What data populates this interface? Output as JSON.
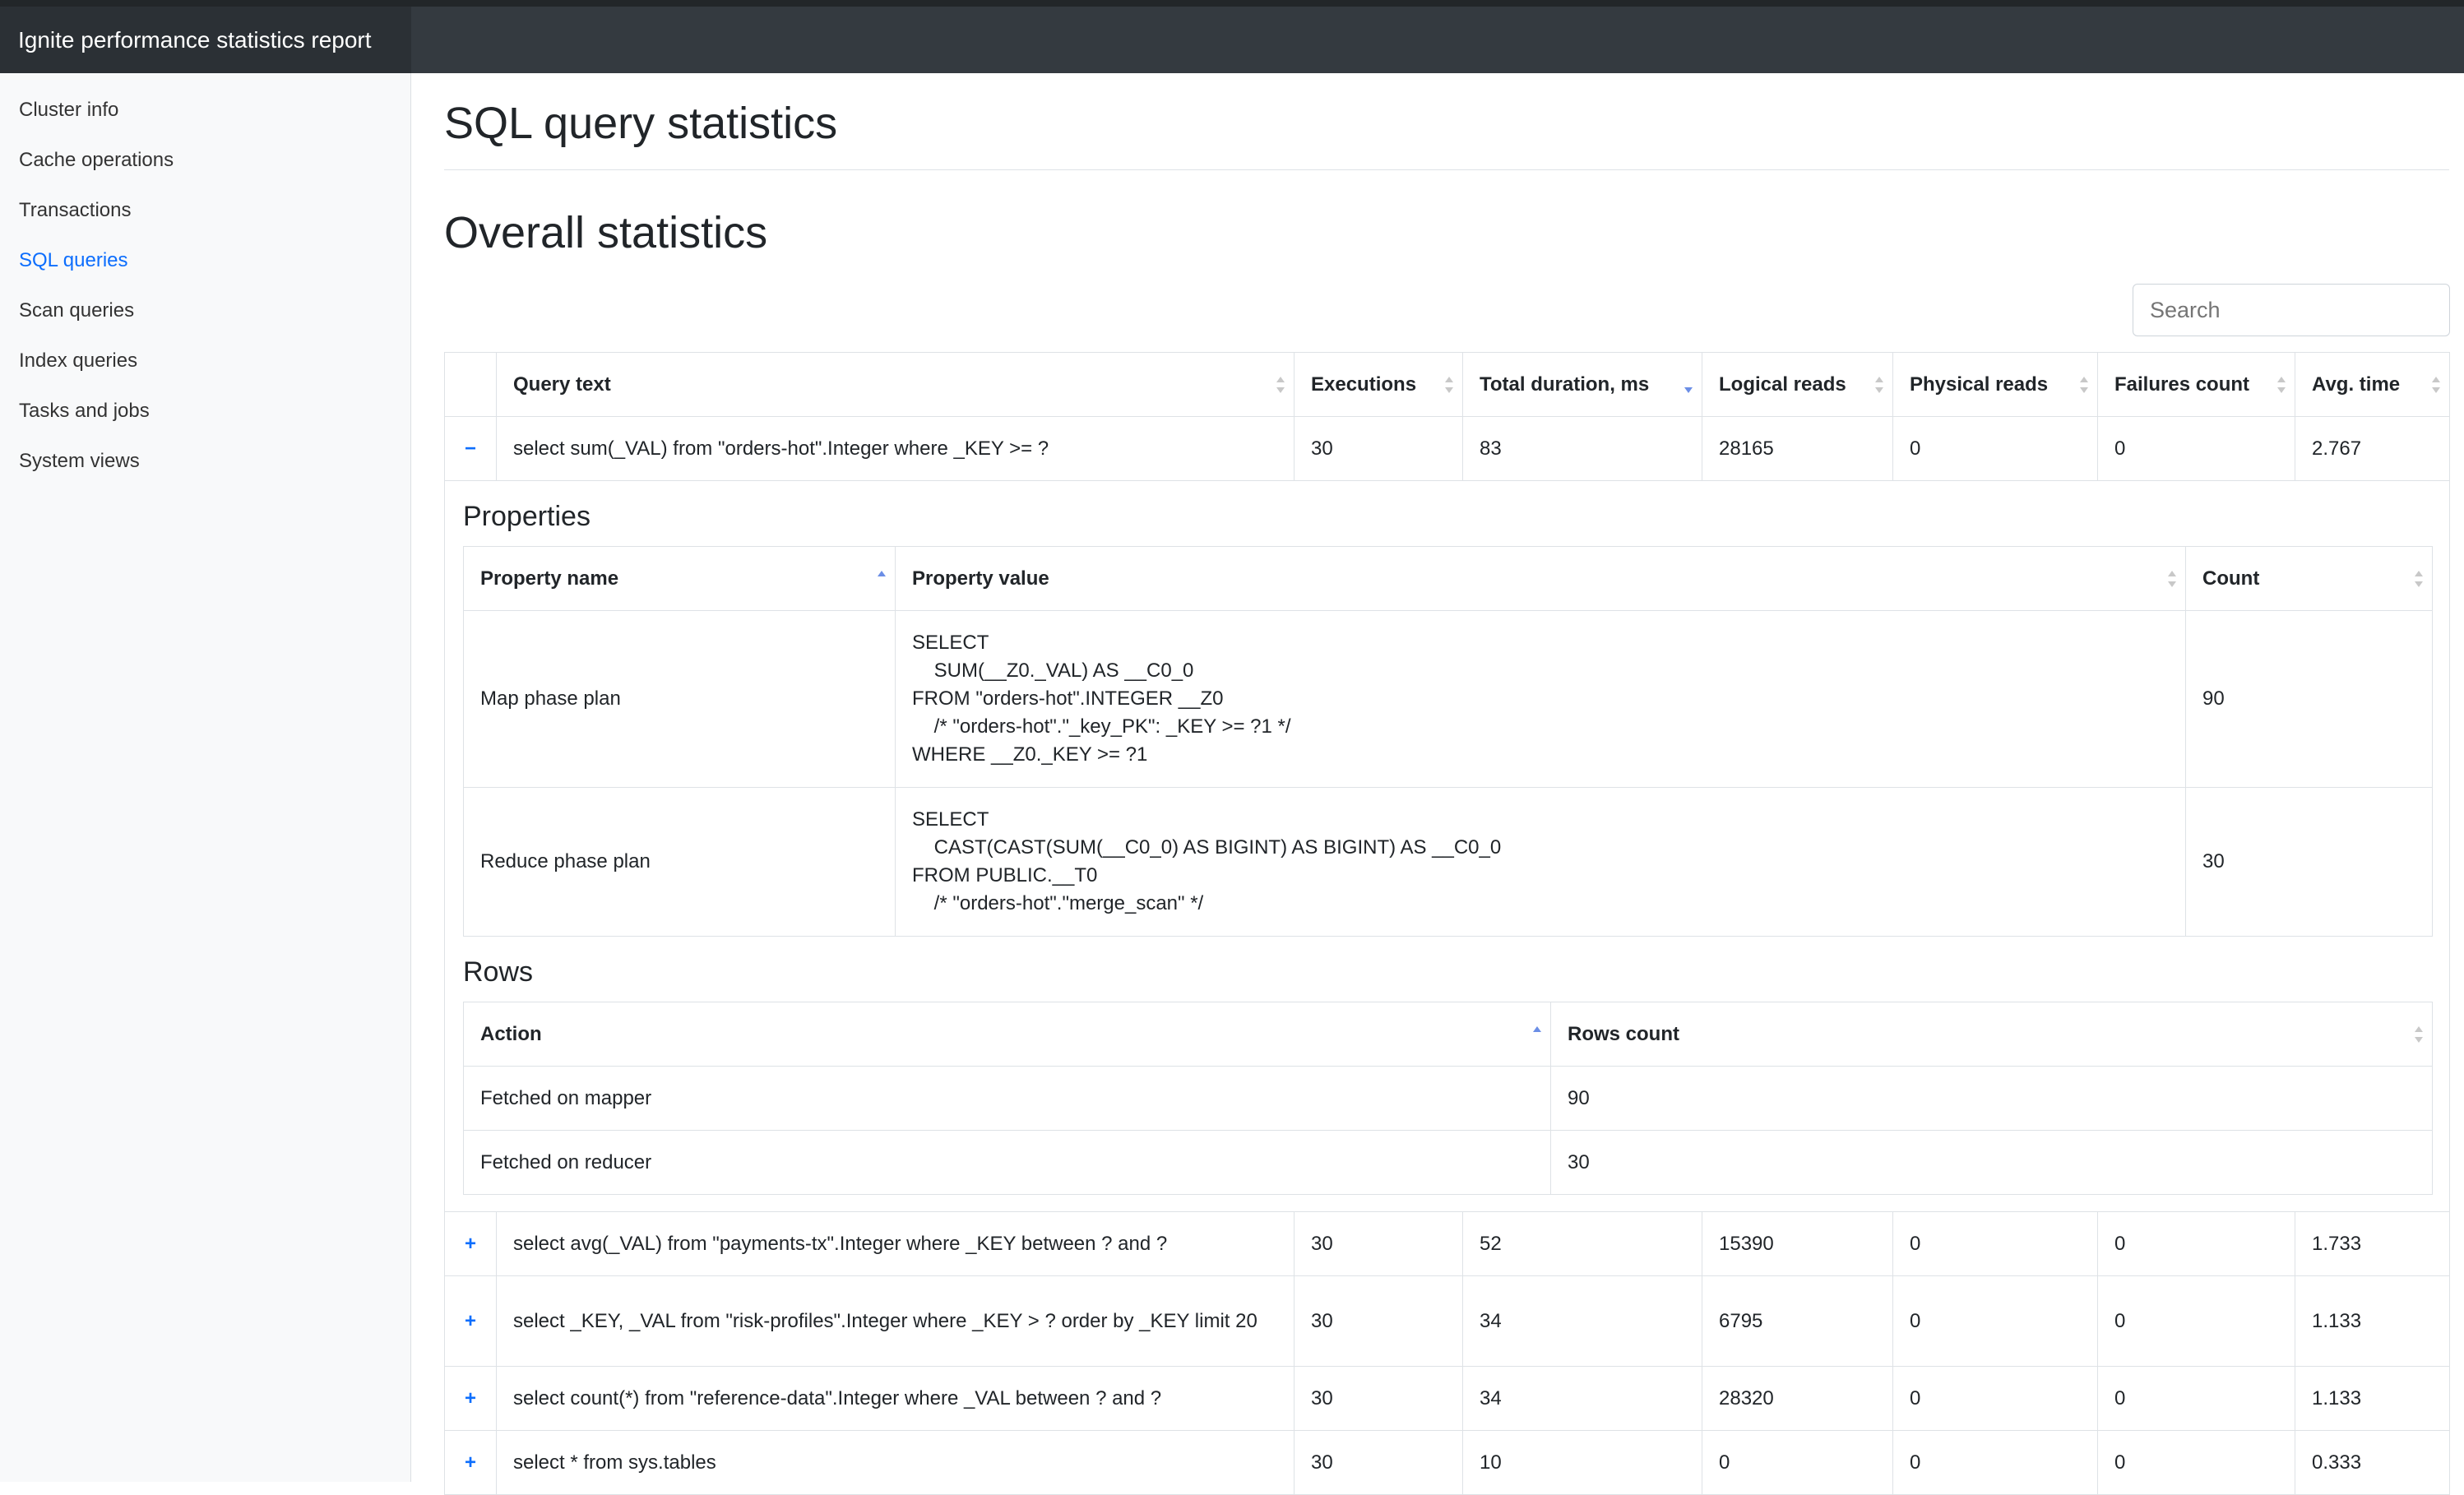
{
  "header": {
    "title": "Ignite performance statistics report"
  },
  "sidebar": {
    "items": [
      {
        "label": "Cluster info"
      },
      {
        "label": "Cache operations"
      },
      {
        "label": "Transactions"
      },
      {
        "label": "SQL queries"
      },
      {
        "label": "Scan queries"
      },
      {
        "label": "Index queries"
      },
      {
        "label": "Tasks and jobs"
      },
      {
        "label": "System views"
      }
    ],
    "active": "SQL queries"
  },
  "page": {
    "title": "SQL query statistics",
    "section_title": "Overall statistics",
    "search_placeholder": "Search"
  },
  "table": {
    "columns": [
      "Query text",
      "Executions",
      "Total duration, ms",
      "Logical reads",
      "Physical reads",
      "Failures count",
      "Avg. time"
    ],
    "sorted_column": "Total duration, ms",
    "sort_direction": "descending",
    "rows": [
      {
        "toggle": "−",
        "query": "select sum(_VAL) from \"orders-hot\".Integer where _KEY >= ?",
        "executions": "30",
        "duration": "83",
        "logical_reads": "28165",
        "physical_reads": "0",
        "failures": "0",
        "avg_time": "2.767"
      },
      {
        "toggle": "+",
        "query": "select avg(_VAL) from \"payments-tx\".Integer where _KEY between ? and ?",
        "executions": "30",
        "duration": "52",
        "logical_reads": "15390",
        "physical_reads": "0",
        "failures": "0",
        "avg_time": "1.733"
      },
      {
        "toggle": "+",
        "query": "select _KEY, _VAL from \"risk-profiles\".Integer where _KEY > ? order by _KEY limit 20",
        "executions": "30",
        "duration": "34",
        "logical_reads": "6795",
        "physical_reads": "0",
        "failures": "0",
        "avg_time": "1.133"
      },
      {
        "toggle": "+",
        "query": "select count(*) from \"reference-data\".Integer where _VAL between ? and ?",
        "executions": "30",
        "duration": "34",
        "logical_reads": "28320",
        "physical_reads": "0",
        "failures": "0",
        "avg_time": "1.133"
      },
      {
        "toggle": "+",
        "query": "select * from sys.tables",
        "executions": "30",
        "duration": "10",
        "logical_reads": "0",
        "physical_reads": "0",
        "failures": "0",
        "avg_time": "0.333"
      }
    ]
  },
  "details": {
    "properties_title": "Properties",
    "properties_columns": [
      "Property name",
      "Property value",
      "Count"
    ],
    "properties": [
      {
        "name": "Map phase plan",
        "value": "SELECT\n    SUM(__Z0._VAL) AS __C0_0\nFROM \"orders-hot\".INTEGER __Z0\n    /* \"orders-hot\".\"_key_PK\": _KEY >= ?1 */\nWHERE __Z0._KEY >= ?1",
        "count": "90"
      },
      {
        "name": "Reduce phase plan",
        "value": "SELECT\n    CAST(CAST(SUM(__C0_0) AS BIGINT) AS BIGINT) AS __C0_0\nFROM PUBLIC.__T0\n    /* \"orders-hot\".\"merge_scan\" */",
        "count": "30"
      }
    ],
    "rows_title": "Rows",
    "rows_columns": [
      "Action",
      "Rows count"
    ],
    "rows": [
      {
        "action": "Fetched on mapper",
        "count": "90"
      },
      {
        "action": "Fetched on reducer",
        "count": "30"
      }
    ]
  }
}
